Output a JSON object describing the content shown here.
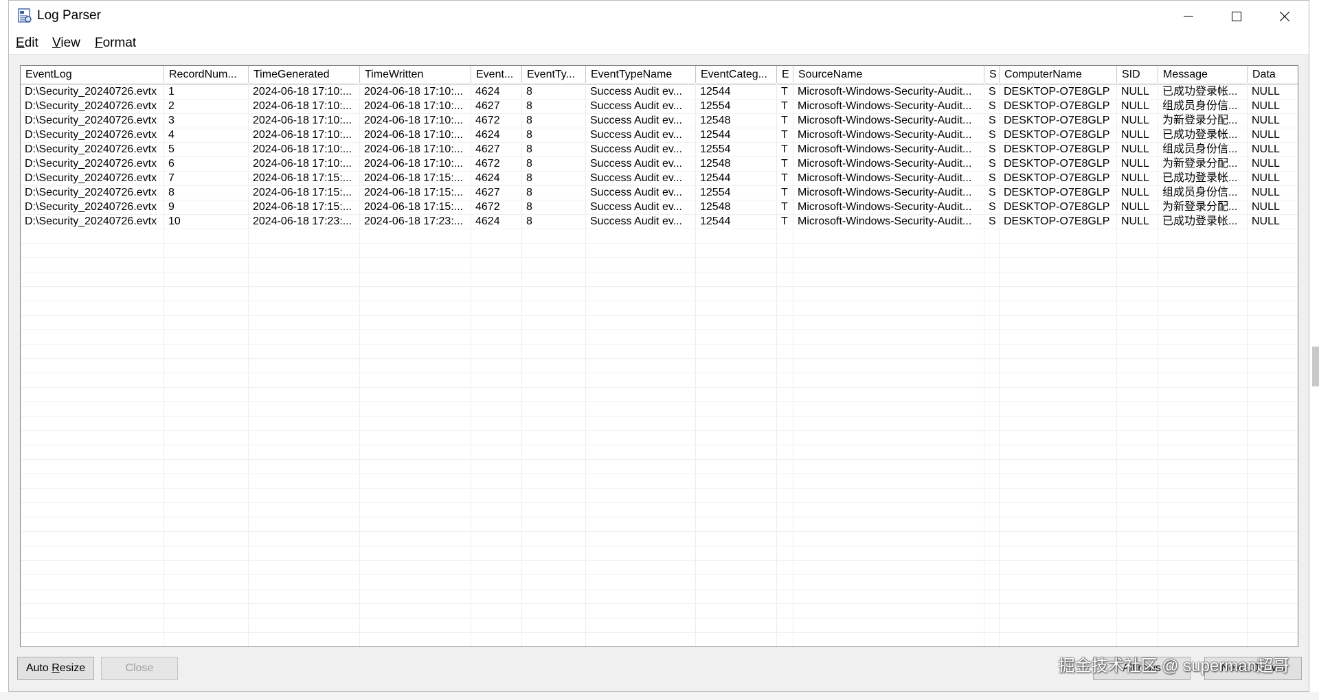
{
  "window": {
    "title": "Log Parser",
    "accent": "#0078d7"
  },
  "menu": [
    {
      "label_ul": "E",
      "label_rest": "dit"
    },
    {
      "label_ul": "V",
      "label_rest": "iew"
    },
    {
      "label_ul": "F",
      "label_rest": "ormat"
    }
  ],
  "columns": [
    "EventLog",
    "RecordNum...",
    "TimeGenerated",
    "TimeWritten",
    "Event...",
    "EventTy...",
    "EventTypeName",
    "EventCateg...",
    "E",
    "SourceName",
    "S",
    "ComputerName",
    "SID",
    "Message",
    "Data"
  ],
  "rows": [
    [
      "D:\\Security_20240726.evtx",
      "1",
      "2024-06-18 17:10:...",
      "2024-06-18 17:10:...",
      "4624",
      "8",
      "Success Audit ev...",
      "12544",
      "T",
      "Microsoft-Windows-Security-Audit...",
      "S",
      "DESKTOP-O7E8GLP",
      "NULL",
      "已成功登录帐...",
      "NULL"
    ],
    [
      "D:\\Security_20240726.evtx",
      "2",
      "2024-06-18 17:10:...",
      "2024-06-18 17:10:...",
      "4627",
      "8",
      "Success Audit ev...",
      "12554",
      "T",
      "Microsoft-Windows-Security-Audit...",
      "S",
      "DESKTOP-O7E8GLP",
      "NULL",
      "组成员身份信...",
      "NULL"
    ],
    [
      "D:\\Security_20240726.evtx",
      "3",
      "2024-06-18 17:10:...",
      "2024-06-18 17:10:...",
      "4672",
      "8",
      "Success Audit ev...",
      "12548",
      "T",
      "Microsoft-Windows-Security-Audit...",
      "S",
      "DESKTOP-O7E8GLP",
      "NULL",
      "为新登录分配...",
      "NULL"
    ],
    [
      "D:\\Security_20240726.evtx",
      "4",
      "2024-06-18 17:10:...",
      "2024-06-18 17:10:...",
      "4624",
      "8",
      "Success Audit ev...",
      "12544",
      "T",
      "Microsoft-Windows-Security-Audit...",
      "S",
      "DESKTOP-O7E8GLP",
      "NULL",
      "已成功登录帐...",
      "NULL"
    ],
    [
      "D:\\Security_20240726.evtx",
      "5",
      "2024-06-18 17:10:...",
      "2024-06-18 17:10:...",
      "4627",
      "8",
      "Success Audit ev...",
      "12554",
      "T",
      "Microsoft-Windows-Security-Audit...",
      "S",
      "DESKTOP-O7E8GLP",
      "NULL",
      "组成员身份信...",
      "NULL"
    ],
    [
      "D:\\Security_20240726.evtx",
      "6",
      "2024-06-18 17:10:...",
      "2024-06-18 17:10:...",
      "4672",
      "8",
      "Success Audit ev...",
      "12548",
      "T",
      "Microsoft-Windows-Security-Audit...",
      "S",
      "DESKTOP-O7E8GLP",
      "NULL",
      "为新登录分配...",
      "NULL"
    ],
    [
      "D:\\Security_20240726.evtx",
      "7",
      "2024-06-18 17:15:...",
      "2024-06-18 17:15:...",
      "4624",
      "8",
      "Success Audit ev...",
      "12544",
      "T",
      "Microsoft-Windows-Security-Audit...",
      "S",
      "DESKTOP-O7E8GLP",
      "NULL",
      "已成功登录帐...",
      "NULL"
    ],
    [
      "D:\\Security_20240726.evtx",
      "8",
      "2024-06-18 17:15:...",
      "2024-06-18 17:15:...",
      "4627",
      "8",
      "Success Audit ev...",
      "12554",
      "T",
      "Microsoft-Windows-Security-Audit...",
      "S",
      "DESKTOP-O7E8GLP",
      "NULL",
      "组成员身份信...",
      "NULL"
    ],
    [
      "D:\\Security_20240726.evtx",
      "9",
      "2024-06-18 17:15:...",
      "2024-06-18 17:15:...",
      "4672",
      "8",
      "Success Audit ev...",
      "12548",
      "T",
      "Microsoft-Windows-Security-Audit...",
      "S",
      "DESKTOP-O7E8GLP",
      "NULL",
      "为新登录分配...",
      "NULL"
    ],
    [
      "D:\\Security_20240726.evtx",
      "10",
      "2024-06-18 17:23:...",
      "2024-06-18 17:23:...",
      "4624",
      "8",
      "Success Audit ev...",
      "12544",
      "T",
      "Microsoft-Windows-Security-Audit...",
      "S",
      "DESKTOP-O7E8GLP",
      "NULL",
      "已成功登录帐...",
      "NULL"
    ]
  ],
  "buttons": {
    "auto_resize_pre": "Auto ",
    "auto_resize_ul": "R",
    "auto_resize_post": "esize",
    "close": "Close",
    "all_rows": "All rows",
    "next_rows": "Next 10 rows"
  },
  "watermark": "掘金技术社区 @ superman超哥",
  "icons": {
    "app": "log-parser-icon",
    "minimize": "minimize-icon",
    "maximize": "maximize-icon",
    "close": "close-icon"
  }
}
